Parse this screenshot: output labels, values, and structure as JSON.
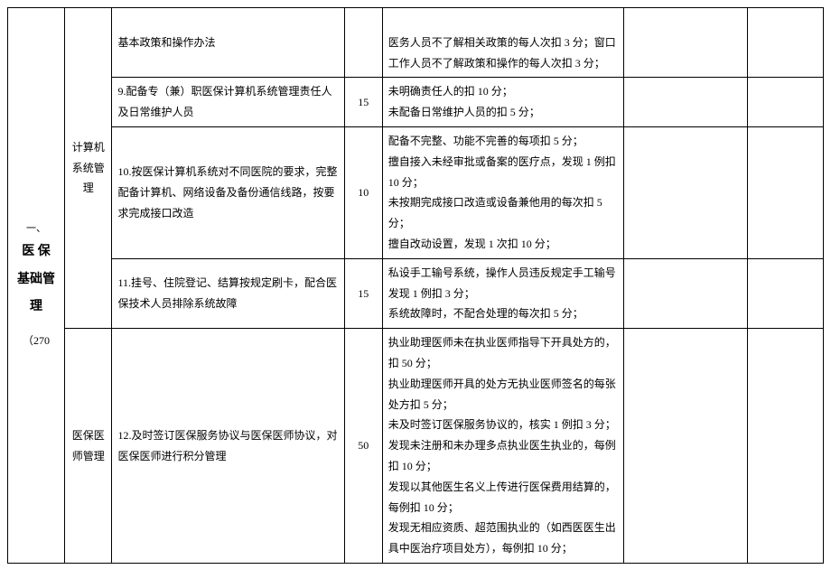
{
  "category": {
    "seq": "一、",
    "name_line1": "医 保",
    "name_line2": "基础管",
    "name_line3": "理",
    "points": "（270"
  },
  "groups": {
    "g1_label": "计算机系统管理",
    "g2_label": "医保医师管理"
  },
  "rows": [
    {
      "item": "基本政策和操作办法",
      "score": "",
      "criteria": "医务人员不了解相关政策的每人次扣 3 分；窗口工作人员不了解政策和操作的每人次扣 3 分；"
    },
    {
      "item": "9.配备专（兼）职医保计算机系统管理责任人及日常维护人员",
      "score": "15",
      "criteria": "未明确责任人的扣 10 分；\n未配备日常维护人员的扣 5 分；"
    },
    {
      "item": "10.按医保计算机系统对不同医院的要求，完整配备计算机、网络设备及备份通信线路，按要求完成接口改造",
      "score": "10",
      "criteria": "配备不完整、功能不完善的每项扣 5 分；\n擅自接入未经审批或备案的医疗点，发现 1 例扣 10 分；\n未按期完成接口改造或设备兼他用的每次扣 5 分；\n擅自改动设置，发现 1 次扣 10 分；"
    },
    {
      "item": "11.挂号、住院登记、结算按规定刷卡，配合医保技术人员排除系统故障",
      "score": "15",
      "criteria": "私设手工输号系统，操作人员违反规定手工输号发现 1 例扣 3 分；\n系统故障时，不配合处理的每次扣 5 分；"
    },
    {
      "item": "12.及时签订医保服务协议与医保医师协议，对医保医师进行积分管理",
      "score": "50",
      "criteria": "执业助理医师未在执业医师指导下开具处方的，扣 50 分；\n执业助理医师开具的处方无执业医师签名的每张处方扣 5 分；\n未及时签订医保服务协议的，核实 1 例扣 3 分；\n发现未注册和未办理多点执业医生执业的，每例扣 10 分；\n发现以其他医生名义上传进行医保费用结算的，每例扣 10 分；\n发现无相应资质、超范围执业的（如西医医生出具中医治疗项目处方），每例扣 10 分；"
    }
  ]
}
